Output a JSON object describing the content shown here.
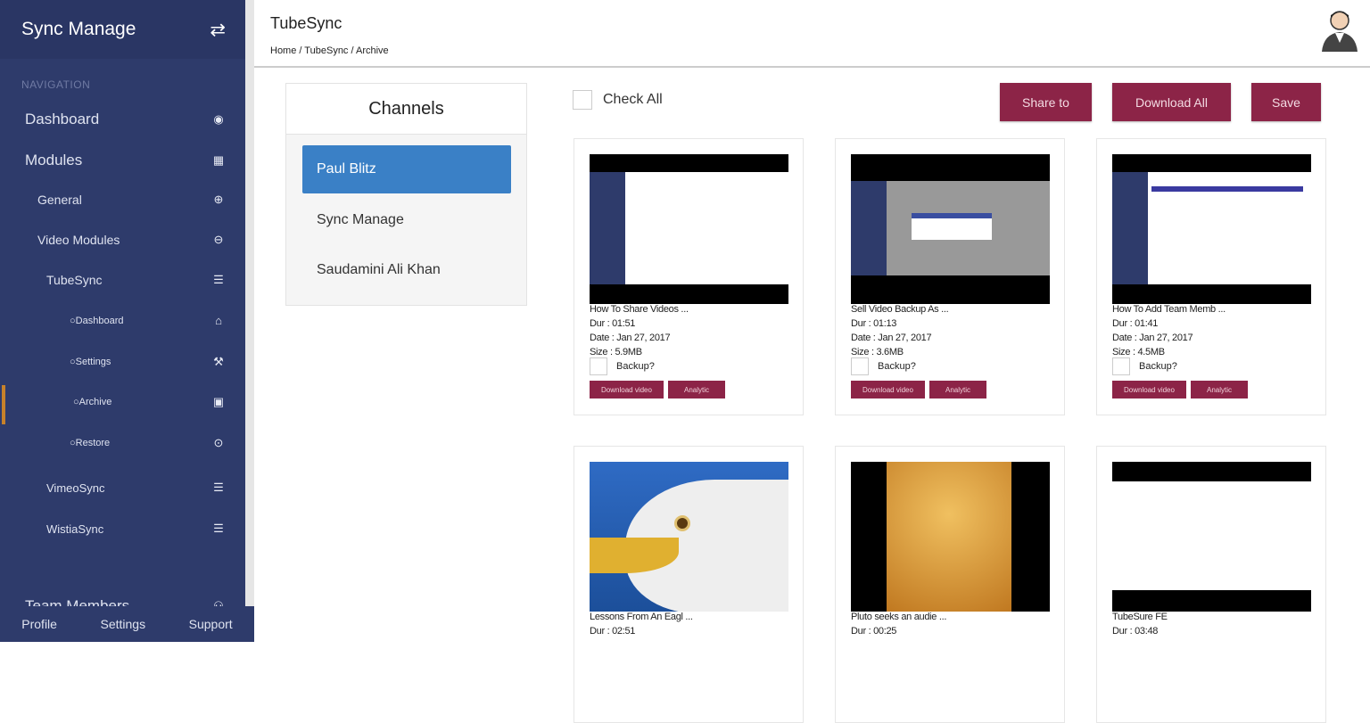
{
  "sidebar": {
    "brand": "Sync Manage",
    "nav_label": "NAVIGATION",
    "items": [
      {
        "label": "Dashboard",
        "icon": "dashboard-icon"
      },
      {
        "label": "Modules",
        "icon": "table-icon"
      },
      {
        "label": "General",
        "icon": "plus-circle-icon"
      },
      {
        "label": "Video Modules",
        "icon": "minus-circle-icon"
      },
      {
        "label": "TubeSync",
        "icon": "list-icon"
      },
      {
        "label": "Dashboard",
        "icon": "home-icon"
      },
      {
        "label": "Settings",
        "icon": "wrench-icon"
      },
      {
        "label": "Archive",
        "icon": "archive-icon"
      },
      {
        "label": "Restore",
        "icon": "restore-icon"
      },
      {
        "label": "VimeoSync",
        "icon": "list-icon"
      },
      {
        "label": "WistiaSync",
        "icon": "list-icon"
      },
      {
        "label": "Team Members",
        "icon": "users-icon"
      }
    ],
    "footer": [
      "Profile",
      "Settings",
      "Support"
    ]
  },
  "header": {
    "title": "TubeSync",
    "breadcrumb": "Home / TubeSync / Archive"
  },
  "channels": {
    "title": "Channels",
    "items": [
      "Paul Blitz",
      "Sync Manage",
      "Saudamini Ali Khan"
    ],
    "selected": 0
  },
  "toolbar": {
    "check_all": "Check All",
    "share": "Share to",
    "download_all": "Download All",
    "save": "Save"
  },
  "videos": [
    {
      "title": "How To Share Videos ...",
      "dur": "Dur : 01:51",
      "date": "Date : Jan 27, 2017",
      "size": "Size : 5.9MB"
    },
    {
      "title": "Sell Video Backup As ...",
      "dur": "Dur : 01:13",
      "date": "Date : Jan 27, 2017",
      "size": "Size : 3.6MB"
    },
    {
      "title": "How To Add Team Memb ...",
      "dur": "Dur : 01:41",
      "date": "Date : Jan 27, 2017",
      "size": "Size : 4.5MB"
    },
    {
      "title": "Lessons From An Eagl ...",
      "dur": "Dur : 02:51"
    },
    {
      "title": "Pluto seeks an audie ...",
      "dur": "Dur : 00:25"
    },
    {
      "title": "TubeSure FE",
      "dur": "Dur : 03:48"
    }
  ],
  "card_labels": {
    "backup": "Backup?",
    "download": "Download video",
    "analytic": "Analytic"
  },
  "colors": {
    "sidebar": "#2e3b6b",
    "accent": "#8c2447",
    "selected": "#3a80c6"
  }
}
